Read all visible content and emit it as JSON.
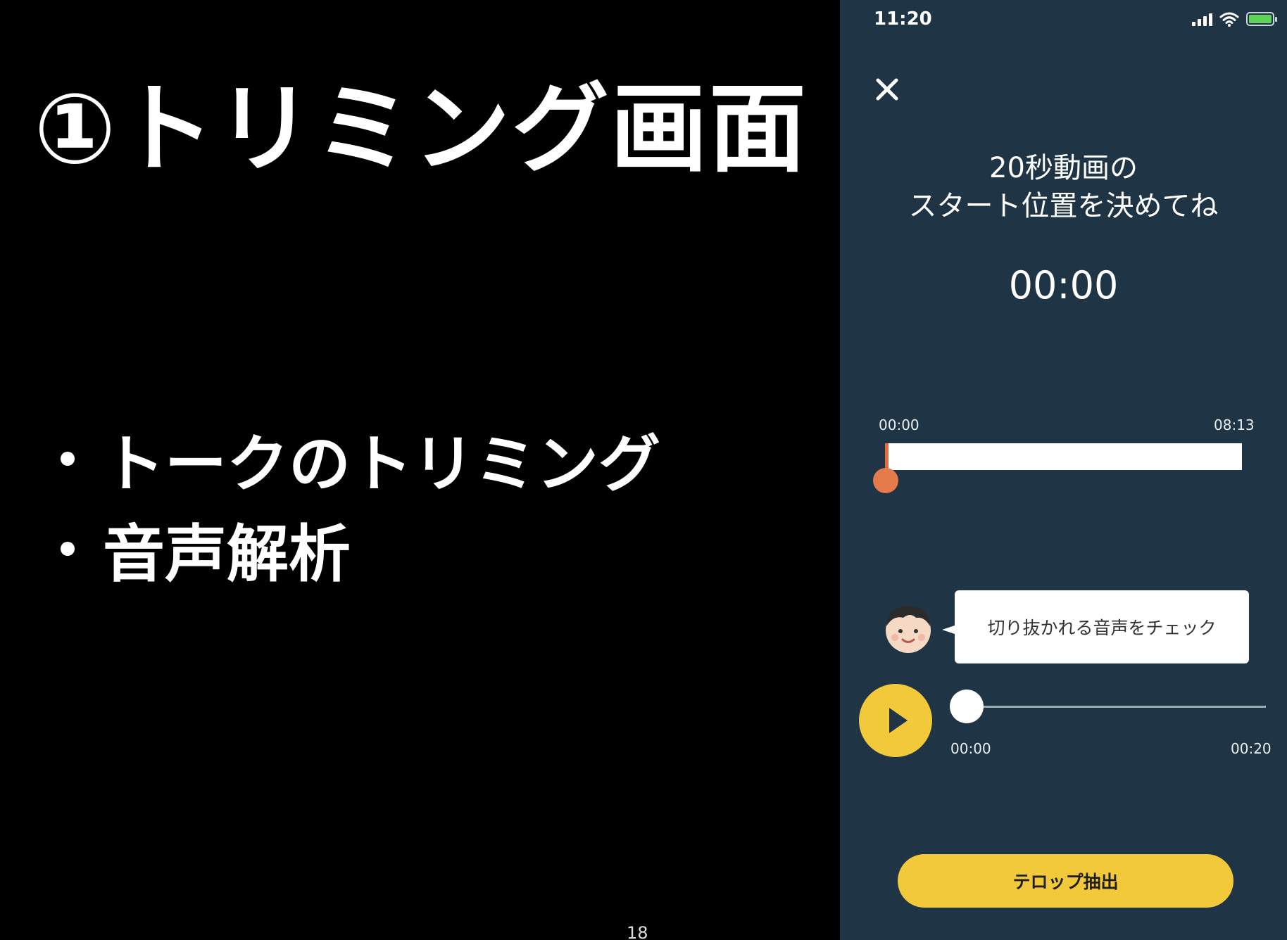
{
  "slide": {
    "title": "①トリミング画面",
    "bullets": [
      "トークのトリミング",
      "音声解析"
    ],
    "page_number": "18"
  },
  "phone": {
    "status_bar": {
      "time": "11:20",
      "icons": [
        "signal-icon",
        "wifi-icon",
        "battery-charging-icon"
      ]
    },
    "close_icon": "close-icon",
    "instruction_line1": "20秒動画の",
    "instruction_line2": "スタート位置を決めてね",
    "current_time": "00:00",
    "trim_range": {
      "start_label": "00:00",
      "end_label": "08:13",
      "selected_start_fraction": 0
    },
    "speech_bubble_text": "切り抜かれる音声をチェック",
    "preview": {
      "start_label": "00:00",
      "end_label": "00:20",
      "progress_fraction": 0
    },
    "extract_button_label": "テロップ抽出",
    "colors": {
      "background": "#1f3444",
      "accent_yellow": "#f3c93c",
      "trim_marker": "#e57a4a"
    }
  }
}
